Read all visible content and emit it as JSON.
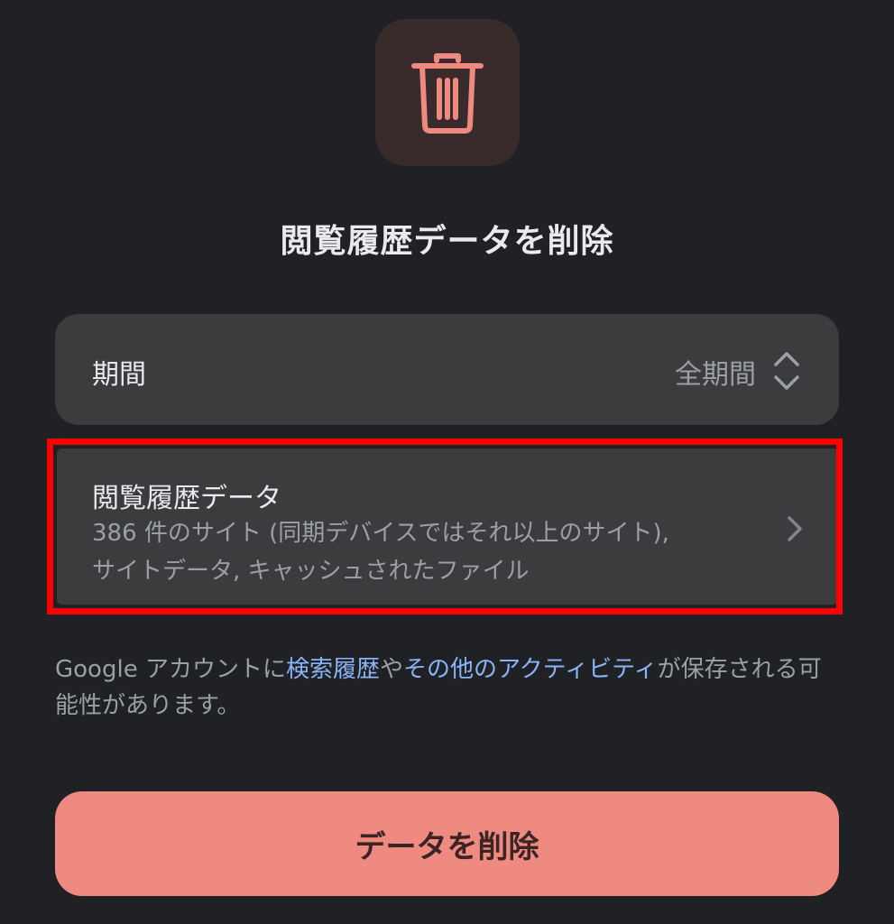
{
  "header": {
    "icon": "trash-icon",
    "title": "閲覧履歴データを削除"
  },
  "period": {
    "label": "期間",
    "value": "全期間",
    "stepper_icon": "chevron-up-down-icon"
  },
  "history": {
    "title": "閲覧履歴データ",
    "desc_line1": "386 件のサイト (同期デバイスではそれ以上のサイト),",
    "desc_line2": "サイトデータ, キャッシュされたファイル",
    "chevron_icon": "chevron-right-icon"
  },
  "notice": {
    "prefix": "Google アカウントに",
    "link1": "検索履歴",
    "middle": "や",
    "link2": "その他のアクティビティ",
    "suffix": "が保存される可能性があります。"
  },
  "footer": {
    "delete_label": "データを削除"
  },
  "colors": {
    "background": "#202124",
    "card": "#3c3c3f",
    "accent": "#ee8a80",
    "link": "#8ab4f8",
    "highlight": "#ff0000"
  }
}
